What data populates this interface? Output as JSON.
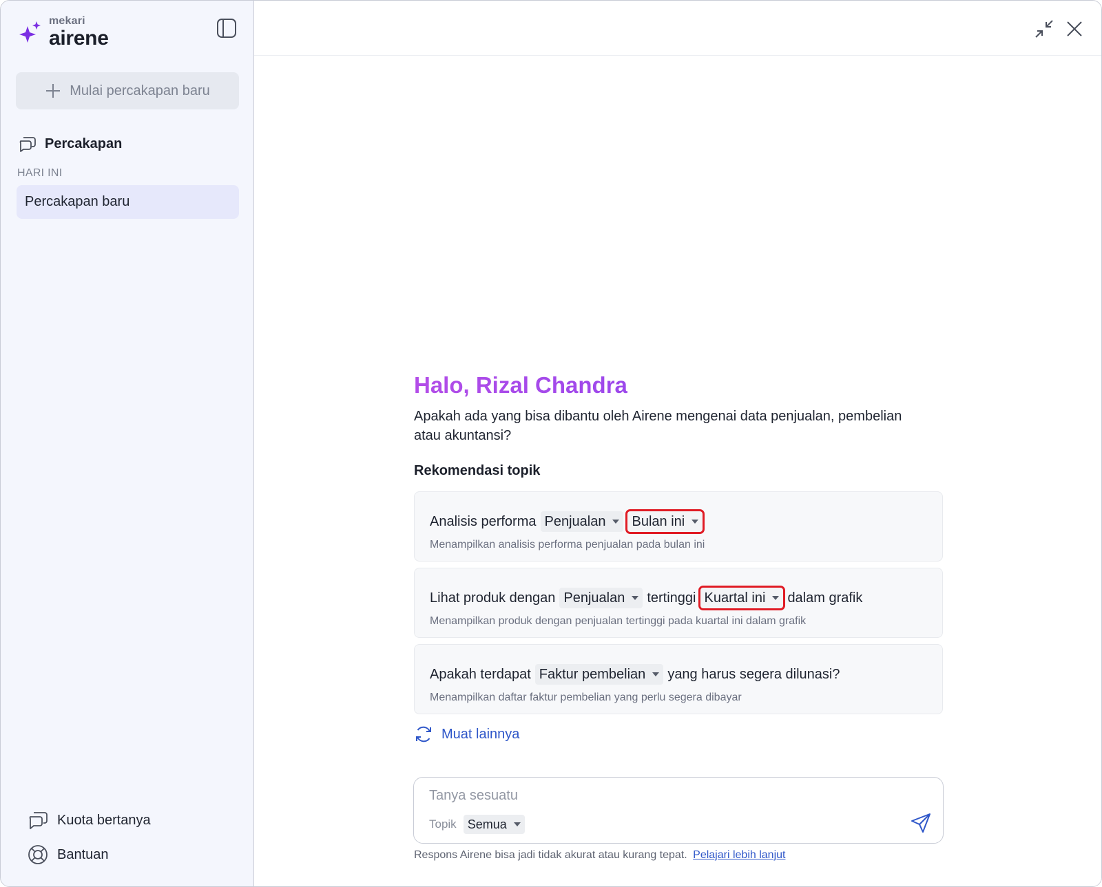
{
  "brand": {
    "small": "mekari",
    "big": "airene"
  },
  "sidebar": {
    "new_chat_label": "Mulai percakapan baru",
    "section_title": "Percakapan",
    "group_label": "HARI INI",
    "conversations": [
      "Percakapan baru"
    ],
    "footer": {
      "quota_label": "Kuota bertanya",
      "help_label": "Bantuan"
    }
  },
  "main": {
    "greeting": "Halo, Rizal Chandra",
    "intro": "Apakah ada yang bisa dibantu oleh Airene mengenai data penjualan, pembelian atau akuntansi?",
    "recommend_title": "Rekomendasi topik",
    "cards": [
      {
        "pre": "Analisis performa",
        "chip1": "Penjualan",
        "chip2": "Bulan ini",
        "subtitle": "Menampilkan analisis performa penjualan pada bulan ini"
      },
      {
        "pre": "Lihat produk dengan",
        "chip1": "Penjualan",
        "mid": "tertinggi",
        "chip2": "Kuartal ini",
        "post": "dalam grafik",
        "subtitle": "Menampilkan produk dengan penjualan tertinggi pada kuartal ini dalam grafik"
      },
      {
        "pre": "Apakah terdapat",
        "chip1": "Faktur pembelian",
        "post": "yang harus segera dilunasi?",
        "subtitle": "Menampilkan daftar faktur pembelian yang perlu segera dibayar"
      }
    ],
    "load_more": "Muat lainnya",
    "composer": {
      "placeholder": "Tanya sesuatu",
      "topic_label": "Topik",
      "topic_value": "Semua"
    },
    "disclaimer": "Respons Airene bisa jadi tidak akurat atau kurang tepat.",
    "learn_more": "Pelajari lebih lanjut"
  },
  "colors": {
    "accent": "#7a3ff0",
    "link": "#2f57c9",
    "highlight": "#e01b24"
  }
}
